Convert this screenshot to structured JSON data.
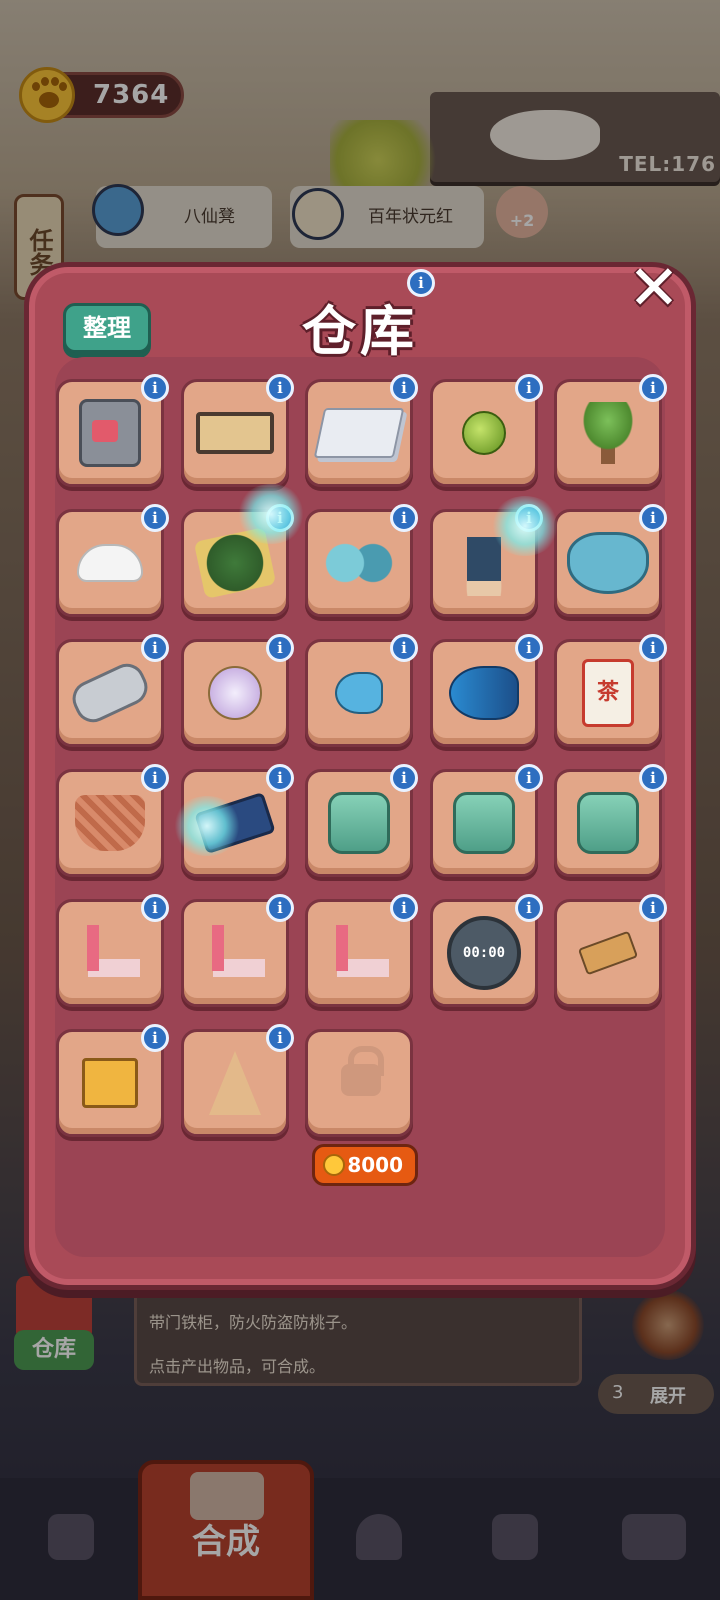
{
  "currency": {
    "icon": "paw-coin-icon",
    "value": "7364"
  },
  "task_button": {
    "label": "任务"
  },
  "orders": [
    {
      "label": "八仙凳",
      "icon": "hammer-icon"
    },
    {
      "label": "百年状元红",
      "icon": "chef-avatar"
    }
  ],
  "order_bonus": "+2",
  "shop_sign": {
    "phone": "TEL:176"
  },
  "warehouse": {
    "title": "仓库",
    "sort_label": "整理",
    "close_icon": "close-icon",
    "info_symbol": "i",
    "items": [
      {
        "name": "safe-with-bucket",
        "icon": "safe-icon"
      },
      {
        "name": "wooden-shelf",
        "icon": "shelf-icon"
      },
      {
        "name": "paper-stack",
        "icon": "paper-stack-icon"
      },
      {
        "name": "green-bead",
        "icon": "green-bead-icon"
      },
      {
        "name": "bonsai-tree",
        "icon": "bonsai-icon"
      },
      {
        "name": "white-cap",
        "icon": "cap-icon"
      },
      {
        "name": "tea-leaves-tray",
        "icon": "tea-tray-icon"
      },
      {
        "name": "puzzle-pieces",
        "icon": "puzzle-icon"
      },
      {
        "name": "fish-statue",
        "icon": "fish-statue-icon"
      },
      {
        "name": "heart-chocolate-box",
        "icon": "chocolate-box-icon"
      },
      {
        "name": "chain-hook",
        "icon": "chain-hook-icon"
      },
      {
        "name": "glass-wind-chime",
        "icon": "wind-chime-icon"
      },
      {
        "name": "small-blue-fish",
        "icon": "fish-small-icon"
      },
      {
        "name": "big-blue-fish",
        "icon": "fish-big-icon"
      },
      {
        "name": "tea-scroll",
        "icon": "tea-scroll-icon",
        "text": "茶"
      },
      {
        "name": "woven-basket",
        "icon": "basket-icon"
      },
      {
        "name": "slate-and-chalk",
        "icon": "slate-icon"
      },
      {
        "name": "glass-jar-1",
        "icon": "jar-icon"
      },
      {
        "name": "glass-jar-2",
        "icon": "jar-icon"
      },
      {
        "name": "glass-jar-3",
        "icon": "jar-icon"
      },
      {
        "name": "flat-iron-1",
        "icon": "iron-icon"
      },
      {
        "name": "flat-iron-2",
        "icon": "iron-icon"
      },
      {
        "name": "flat-iron-3",
        "icon": "iron-icon"
      },
      {
        "name": "digital-timer",
        "icon": "timer-icon",
        "text": "00:00"
      },
      {
        "name": "wooden-clip",
        "icon": "clip-icon"
      },
      {
        "name": "gift-box",
        "icon": "gift-box-icon"
      },
      {
        "name": "sauce-bottle",
        "icon": "sauce-bottle-icon"
      }
    ],
    "locked_slot": {
      "icon": "padlock-icon",
      "price": "8000",
      "price_icon": "paw-coin-icon"
    }
  },
  "storage_button": {
    "label": "仓库"
  },
  "hint": {
    "line1": "带门铁柜，防火防盗防桃子。",
    "line2": "点击产出物品，可合成。"
  },
  "expand": {
    "count": "3",
    "label": "展开"
  },
  "bottom_nav": [
    {
      "name": "bag",
      "icon": "bag-icon",
      "label": ""
    },
    {
      "name": "merge",
      "icon": "merge-icon",
      "label": "合成",
      "active": true
    },
    {
      "name": "kitchen",
      "icon": "cloche-icon",
      "label": ""
    },
    {
      "name": "map",
      "icon": "map-icon",
      "label": ""
    },
    {
      "name": "bus",
      "icon": "bus-icon",
      "label": ""
    }
  ],
  "colors": {
    "modal_bg": "#a94a57",
    "slot_bg": "#e2a688",
    "info_blue": "#2d6ec0",
    "sort_green": "#3fa28a",
    "price_orange": "#e65a12",
    "nav_active": "#b8432e"
  }
}
